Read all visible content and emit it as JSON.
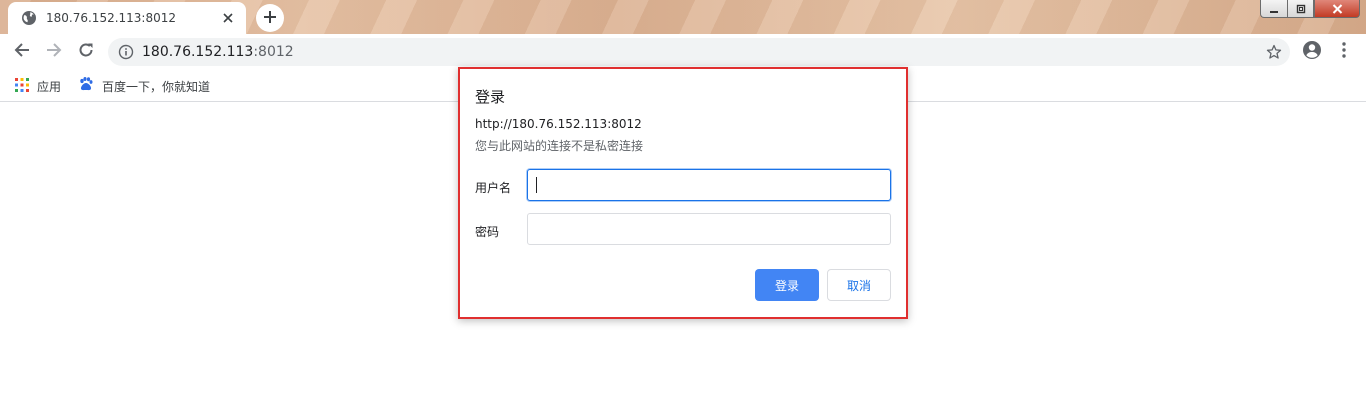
{
  "tab": {
    "title": "180.76.152.113:8012",
    "favicon_icon": "globe-icon",
    "close_icon": "close-icon"
  },
  "newtab": {
    "icon": "plus-icon"
  },
  "window_controls": {
    "minimize_icon": "minimize-icon",
    "maximize_icon": "maximize-icon",
    "close_icon": "close-icon"
  },
  "toolbar": {
    "back_icon": "back-arrow-icon",
    "forward_icon": "forward-arrow-icon",
    "reload_icon": "reload-icon",
    "omnibox": {
      "info_icon": "info-icon",
      "host": "180.76.152.113",
      "port": ":8012",
      "star_icon": "star-icon"
    },
    "profile_icon": "account-icon",
    "menu_icon": "kebab-menu-icon"
  },
  "bookmarks": [
    {
      "label": "应用",
      "icon": "apps-grid-icon"
    },
    {
      "label": "百度一下，你就知道",
      "icon": "baidu-paw-icon"
    }
  ],
  "dialog": {
    "title": "登录",
    "origin": "http://180.76.152.113:8012",
    "note": "您与此网站的连接不是私密连接",
    "username_label": "用户名",
    "username_value": "",
    "password_label": "密码",
    "password_value": "",
    "login_button": "登录",
    "cancel_button": "取消"
  },
  "colors": {
    "dialog_highlight": "#e02f2f",
    "primary_button": "#4285f4",
    "link_blue": "#1a73e8"
  }
}
